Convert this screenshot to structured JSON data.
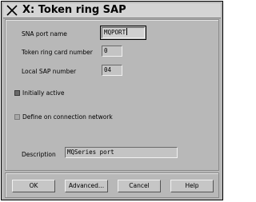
{
  "window": {
    "title": "X: Token ring SAP",
    "close_icon": "x-close-icon"
  },
  "form": {
    "sna_port_name": {
      "label": "SNA port name",
      "value": "MQPORT"
    },
    "token_ring_card_number": {
      "label": "Token ring card number",
      "value": "0"
    },
    "local_sap_number": {
      "label": "Local SAP number",
      "value": "04"
    },
    "initially_active": {
      "label": "Initially active",
      "checked": true
    },
    "define_on_connection_network": {
      "label": "Define on connection network",
      "checked": false
    },
    "description": {
      "label": "Description",
      "value": "MQSeries port"
    }
  },
  "buttons": {
    "ok": "OK",
    "advanced": "Advanced...",
    "cancel": "Cancel",
    "help": "Help"
  }
}
